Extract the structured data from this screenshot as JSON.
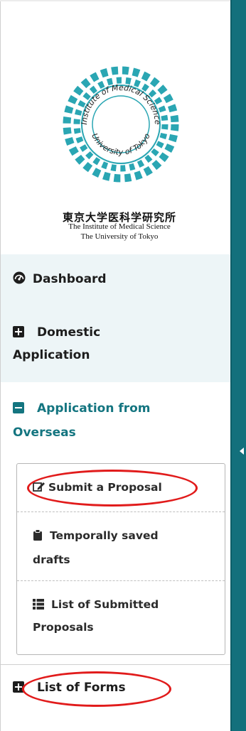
{
  "logo": {
    "ring_top_text": "Institute of Medical Science",
    "ring_bottom_text": "University of Tokyo",
    "name_jp": "東京大学医科学研究所",
    "name_en_line1": "The Institute of Medical Science",
    "name_en_line2": "The University of Tokyo"
  },
  "nav": {
    "dashboard": "Dashboard",
    "domestic_line1": "Domestic",
    "domestic_line2": "Application",
    "overseas_line1": "Application from",
    "overseas_line2": "Overseas",
    "list_of_forms": "List of Forms"
  },
  "submenu": {
    "submit_proposal": "Submit a Proposal",
    "drafts_line1": "Temporally saved",
    "drafts_line2": "drafts",
    "submitted_line1": "List of Submitted",
    "submitted_line2": "Proposals"
  },
  "colors": {
    "accent_teal": "#147580",
    "side_bar": "#13707c",
    "highlight_oval": "#e11b1b",
    "active_bg": "#edf5f7"
  },
  "icons": {
    "dashboard": "dashboard-gauge-icon",
    "domestic": "plus-square-icon",
    "overseas": "minus-square-icon",
    "submit": "edit-icon",
    "drafts": "clipboard-icon",
    "submitted": "list-icon",
    "forms": "plus-square-icon",
    "collapse": "caret-left-icon"
  }
}
